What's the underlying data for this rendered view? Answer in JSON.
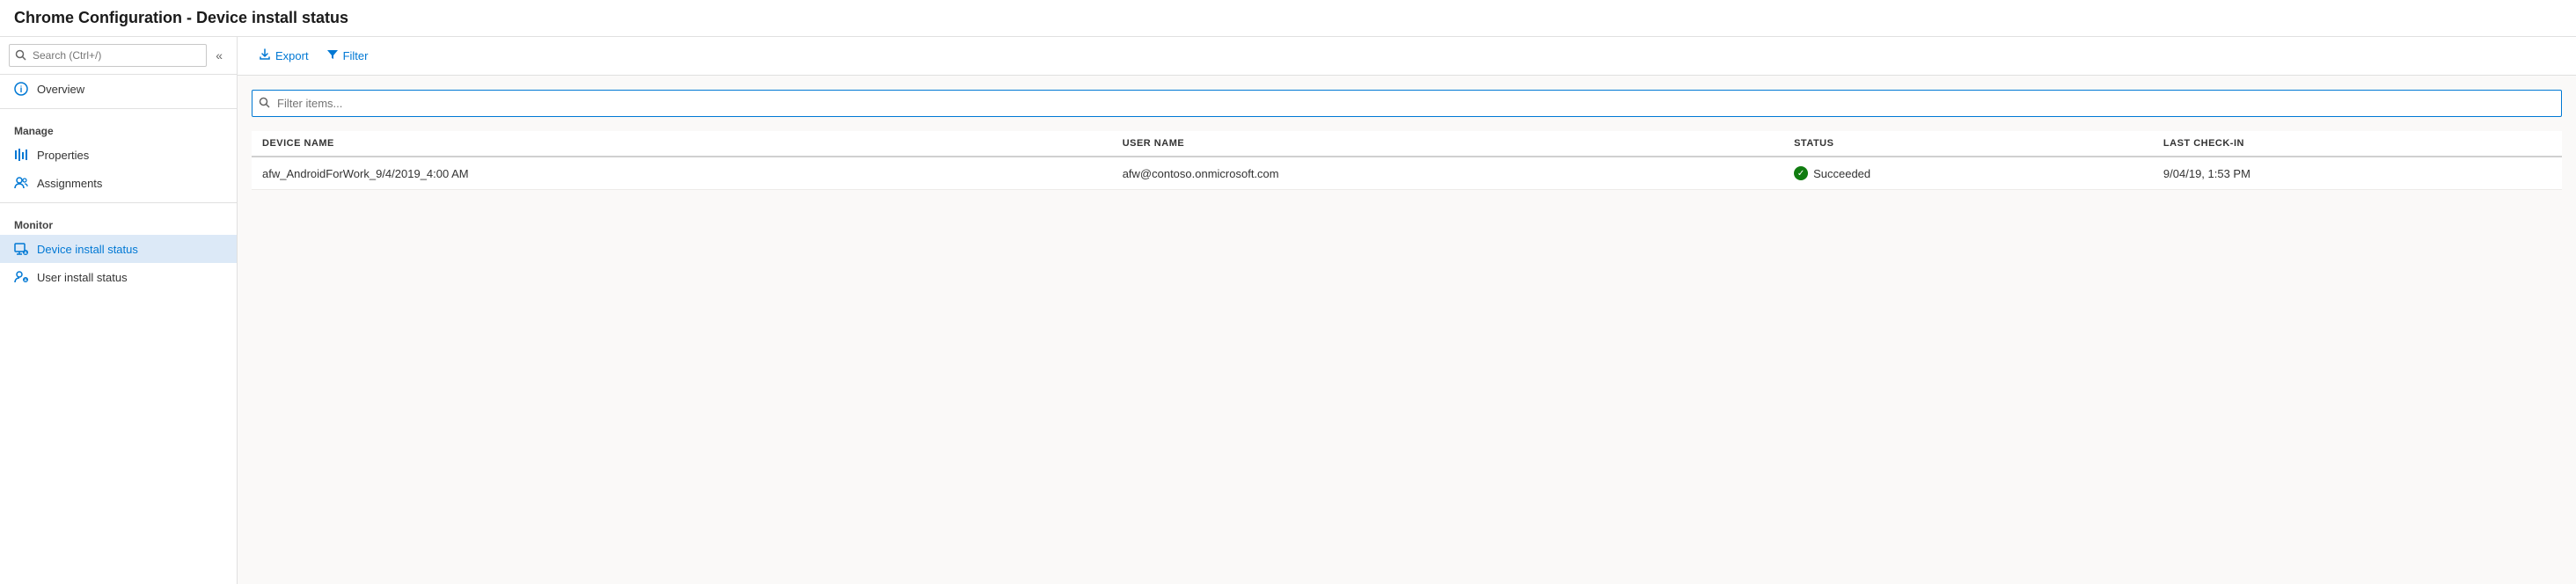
{
  "title": "Chrome Configuration - Device install status",
  "sidebar": {
    "search_placeholder": "Search (Ctrl+/)",
    "collapse_icon": "«",
    "sections": [
      {
        "label": "",
        "items": [
          {
            "id": "overview",
            "label": "Overview",
            "icon": "info",
            "active": false
          }
        ]
      },
      {
        "label": "Manage",
        "items": [
          {
            "id": "properties",
            "label": "Properties",
            "icon": "properties",
            "active": false
          },
          {
            "id": "assignments",
            "label": "Assignments",
            "icon": "assignments",
            "active": false
          }
        ]
      },
      {
        "label": "Monitor",
        "items": [
          {
            "id": "device-install-status",
            "label": "Device install status",
            "icon": "device",
            "active": true
          },
          {
            "id": "user-install-status",
            "label": "User install status",
            "icon": "user",
            "active": false
          }
        ]
      }
    ]
  },
  "toolbar": {
    "export_label": "Export",
    "filter_label": "Filter"
  },
  "filter_placeholder": "Filter items...",
  "table": {
    "columns": [
      {
        "id": "device-name",
        "label": "DEVICE NAME"
      },
      {
        "id": "user-name",
        "label": "USER NAME"
      },
      {
        "id": "status",
        "label": "STATUS"
      },
      {
        "id": "last-checkin",
        "label": "LAST CHECK-IN"
      }
    ],
    "rows": [
      {
        "device_name": "afw_AndroidForWork_9/4/2019_4:00 AM",
        "user_name": "afw@contoso.onmicrosoft.com",
        "status": "Succeeded",
        "last_checkin": "9/04/19, 1:53 PM"
      }
    ]
  }
}
